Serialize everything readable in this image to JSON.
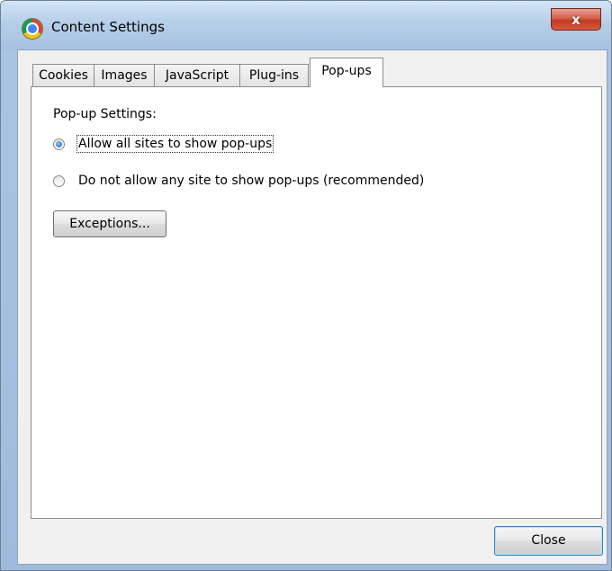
{
  "window": {
    "title": "Content Settings",
    "close_glyph": "x"
  },
  "tabs": [
    {
      "label": "Cookies",
      "selected": false
    },
    {
      "label": "Images",
      "selected": false
    },
    {
      "label": "JavaScript",
      "selected": false
    },
    {
      "label": "Plug-ins",
      "selected": false
    },
    {
      "label": "Pop-ups",
      "selected": true
    }
  ],
  "popups": {
    "section_label": "Pop-up Settings:",
    "options": [
      {
        "label": "Allow all sites to show pop-ups",
        "checked": true
      },
      {
        "label": "Do not allow any site to show pop-ups (recommended)",
        "checked": false
      }
    ],
    "exceptions_label": "Exceptions..."
  },
  "footer": {
    "close_label": "Close"
  },
  "icons": {
    "app": "chrome-icon",
    "window_close": "close-icon"
  },
  "colors": {
    "title_bar": "#b8d0ea",
    "close_button": "#c23a23",
    "radio_selected": "#1b67c9",
    "default_button_border": "#3c7fb1"
  }
}
